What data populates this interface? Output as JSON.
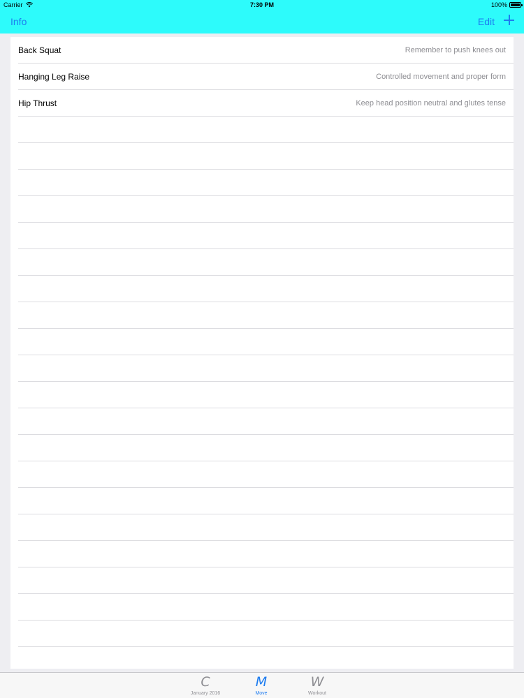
{
  "status_bar": {
    "carrier": "Carrier",
    "time": "7:30 PM",
    "battery": "100%",
    "icons": [
      "wifi-icon",
      "battery-icon"
    ]
  },
  "nav_bar": {
    "left_button": "Info",
    "right_button": "Edit",
    "add_icon": "plus-icon",
    "background_color": "#2dfbfb",
    "tint_color": "#1d7cf0"
  },
  "exercises": [
    {
      "name": "Back Squat",
      "note": "Remember to push knees out"
    },
    {
      "name": "Hanging Leg Raise",
      "note": "Controlled movement and proper form"
    },
    {
      "name": "Hip Thrust",
      "note": "Keep head position neutral and glutes tense"
    }
  ],
  "tab_bar": {
    "tabs": [
      {
        "icon": "C",
        "label": "January 2016",
        "active": false
      },
      {
        "icon": "M",
        "label": "Move",
        "active": true
      },
      {
        "icon": "W",
        "label": "Workout",
        "active": false
      }
    ]
  }
}
